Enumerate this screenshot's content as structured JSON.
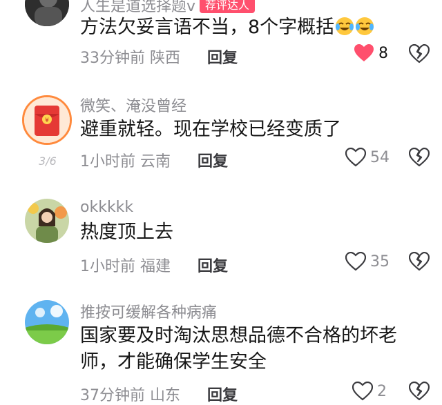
{
  "comments": [
    {
      "username": "人生是道选择题v",
      "badge": "荐评达人",
      "text": "方法欠妥言语不当，8个字概括",
      "emojis": [
        "crying-laugh",
        "crying-laugh"
      ],
      "time": "33分钟前",
      "location": "陕西",
      "reply_label": "回复",
      "likes": "8",
      "liked": true
    },
    {
      "username": "微笑、淹没曾经",
      "text": "避重就轻。现在学校已经变质了",
      "time": "1小时前",
      "location": "云南",
      "reply_label": "回复",
      "likes": "54",
      "liked": false,
      "avatar_pager": "3/6"
    },
    {
      "username": "okkkkk",
      "text": "热度顶上去",
      "time": "1小时前",
      "location": "福建",
      "reply_label": "回复",
      "likes": "35",
      "liked": false
    },
    {
      "username": "推按可缓解各种病痛",
      "text": "国家要及时淘汰思想品德不合格的坏老师，才能确保学生安全",
      "time": "37分钟前",
      "location": "山东",
      "reply_label": "回复",
      "likes": "2",
      "liked": false
    }
  ],
  "colors": {
    "liked_heart": "#ff4f6d",
    "meta_gray": "#8d8d92",
    "text_dark": "#161616"
  },
  "icons": {
    "like": "heart-icon",
    "dislike": "broken-heart-icon"
  }
}
